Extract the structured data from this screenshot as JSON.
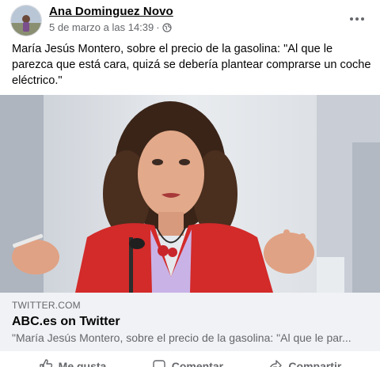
{
  "post": {
    "author": "Ana Dominguez Novo",
    "timestamp": "5 de marzo a las 14:39",
    "separator": "·",
    "privacy_icon": "globe-icon",
    "more_icon": "more-options-icon",
    "text": "María Jesús Montero, sobre el precio de la gasolina: \"Al que le parezca que está cara, quizá se debería plantear comprarse un coche eléctrico.\""
  },
  "link_preview": {
    "domain": "TWITTER.COM",
    "title": "ABC.es on Twitter",
    "description": "\"María Jesús Montero, sobre el precio de la gasolina: \"Al que le par..."
  },
  "actions": {
    "like_label": "Me gusta",
    "comment_label": "Comentar",
    "share_label": "Compartir"
  },
  "colors": {
    "primary_text": "#050505",
    "secondary_text": "#65676b",
    "card_background": "#f0f2f5",
    "jacket_red": "#d32a2a"
  }
}
